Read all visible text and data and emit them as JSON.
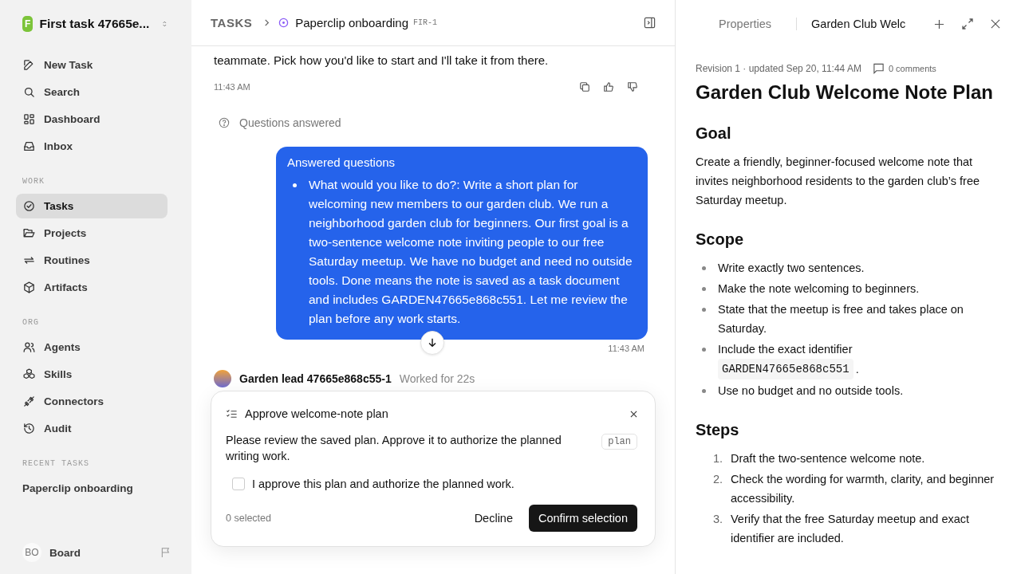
{
  "workspace": {
    "logo": "F",
    "name": "First task 47665e..."
  },
  "nav": [
    {
      "label": "New Task",
      "selected": false
    },
    {
      "label": "Search",
      "selected": false
    },
    {
      "label": "Dashboard",
      "selected": false
    },
    {
      "label": "Inbox",
      "selected": false
    }
  ],
  "sections": [
    {
      "title": "WORK",
      "items": [
        {
          "label": "Tasks",
          "selected": true
        },
        {
          "label": "Projects",
          "selected": false
        },
        {
          "label": "Routines",
          "selected": false
        },
        {
          "label": "Artifacts",
          "selected": false
        }
      ]
    },
    {
      "title": "ORG",
      "items": [
        {
          "label": "Agents",
          "selected": false
        },
        {
          "label": "Skills",
          "selected": false
        },
        {
          "label": "Connectors",
          "selected": false
        },
        {
          "label": "Audit",
          "selected": false
        }
      ]
    }
  ],
  "recent": {
    "title": "RECENT TASKS",
    "items": [
      "Paperclip onboarding"
    ]
  },
  "user": {
    "initials": "BO",
    "name": "Board"
  },
  "breadcrumb": {
    "root": "TASKS",
    "title": "Paperclip onboarding",
    "id": "FIR-1"
  },
  "chat": {
    "intro_tail": "teammate. Pick how you'd like to start and I'll take it from there.",
    "intro_time": "11:43 AM",
    "questions_label": "Questions answered",
    "bubble": {
      "title": "Answered questions",
      "items": [
        "What would you like to do?: Write a short plan for welcoming new members to our garden club. We run a neighborhood garden club for beginners. Our first goal is a two-sentence welcome note inviting people to our free Saturday meetup. We have no budget and need no outside tools. Done means the note is saved as a task document and includes GARDEN47665e868c551. Let me review the plan before any work starts."
      ],
      "time": "11:43 AM"
    },
    "author": "Garden lead 47665e868c55-1",
    "worked": "Worked for 22s"
  },
  "approval": {
    "title": "Approve welcome-note plan",
    "text": "Please review the saved plan. Approve it to authorize the planned writing work.",
    "tag": "plan",
    "options": [
      {
        "label": "I approve this plan and authorize the planned work.",
        "checked": false
      }
    ],
    "count": "0 selected",
    "decline": "Decline",
    "confirm": "Confirm selection"
  },
  "panel": {
    "tabs": [
      {
        "label": "Properties",
        "selected": false
      },
      {
        "label": "Garden Club Welc",
        "selected": true
      }
    ],
    "meta": "Revision 1 · updated Sep 20, 11:44 AM",
    "comments": "0 comments",
    "title": "Garden Club Welcome Note Plan",
    "sections": [
      {
        "heading": "Goal",
        "kind": "paragraph",
        "text": "Create a friendly, beginner-focused welcome note that invites neighborhood residents to the garden club’s free Saturday meetup."
      },
      {
        "heading": "Scope",
        "kind": "bullets",
        "items": [
          {
            "text": "Write exactly two sentences."
          },
          {
            "text": "Make the note welcoming to beginners."
          },
          {
            "text": "State that the meetup is free and takes place on Saturday."
          },
          {
            "text": "Include the exact identifier",
            "code": "GARDEN47665e868c551",
            "after": "."
          },
          {
            "text": "Use no budget and no outside tools."
          }
        ]
      },
      {
        "heading": "Steps",
        "kind": "numbered",
        "items": [
          {
            "num": "1.",
            "text": "Draft the two-sentence welcome note."
          },
          {
            "num": "2.",
            "text": "Check the wording for warmth, clarity, and beginner accessibility."
          },
          {
            "num": "3.",
            "text": "Verify that the free Saturday meetup and exact identifier are included."
          }
        ]
      }
    ]
  }
}
